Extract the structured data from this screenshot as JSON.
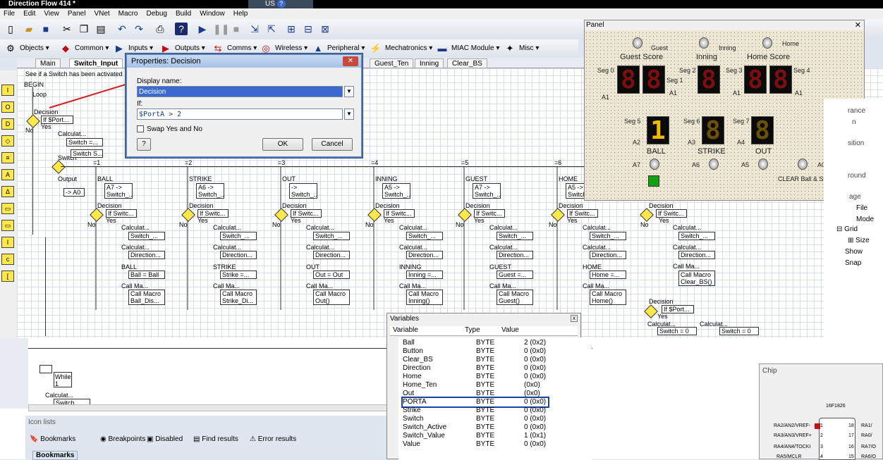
{
  "window": {
    "title": "Direction Flow 414 *",
    "lang": "US"
  },
  "menu": [
    "File",
    "Edit",
    "View",
    "Panel",
    "VNet",
    "Macro",
    "Debug",
    "Build",
    "Window",
    "Help"
  ],
  "components": [
    {
      "label": "Objects"
    },
    {
      "label": "Common"
    },
    {
      "label": "Inputs"
    },
    {
      "label": "Outputs"
    },
    {
      "label": "Comms"
    },
    {
      "label": "Wireless"
    },
    {
      "label": "Peripheral"
    },
    {
      "label": "Mechatronics"
    },
    {
      "label": "MIAC Module"
    },
    {
      "label": "Misc"
    }
  ],
  "tabs": [
    "Main",
    "Switch_Input",
    "Guest_Ten",
    "Inning",
    "Clear_BS"
  ],
  "canvas": {
    "comment": "See if a Switch has been activated",
    "begin": "BEGIN",
    "loop": "Loop",
    "decision": "Decision",
    "if_port": "If  $Port...",
    "no": "No",
    "yes": "Yes",
    "calc": "Calculat...",
    "switch_eq": "Switch =...",
    "switch_lbl": "Switch",
    "switch_s": "Switch S...",
    "output": "Output",
    "a0": "-> A0",
    "while": "While",
    "while1": "1"
  },
  "cases": [
    {
      "num": "=1",
      "name": "BALL",
      "a": "A7 ->",
      "sw": "Switch_...",
      "var": "Ball = Ball",
      "macro": "Ball_Dis..."
    },
    {
      "num": "=2",
      "name": "STRIKE",
      "a": "A6 ->",
      "sw": "Switch_...",
      "var": "Strike =...",
      "macro": "Strike_Di..."
    },
    {
      "num": "=3",
      "name": "OUT",
      "a": "-> ",
      "sw": "Switch_...",
      "var": "Out = Out",
      "macro": "Out()"
    },
    {
      "num": "=4",
      "name": "INNING",
      "a": "A5 ->",
      "sw": "Switch_...",
      "var": "Inning =...",
      "macro": "Inning()"
    },
    {
      "num": "=5",
      "name": "GUEST",
      "a": "A7 ->",
      "sw": "Switch_...",
      "var": "Guest =...",
      "macro": "Guest()"
    },
    {
      "num": "=6",
      "name": "HOME",
      "a": "A5 ->",
      "sw": "Switch",
      "var": "Home =...",
      "macro": "Home()"
    }
  ],
  "case_labels": {
    "decision": "Decision",
    "if": "If  Switc...",
    "calc": "Calculat...",
    "switch": "Switch_...",
    "direction": "Direction...",
    "callma": "Call Ma...",
    "callmacro": "Call Macro",
    "no": "No",
    "yes": "Yes"
  },
  "clear_case": {
    "callma": "Call Ma...",
    "callmacro": "Call Macro",
    "macro": "Clear_BS()",
    "decision": "Decision",
    "if": "If  $Port...",
    "yes": "Yes",
    "calc": "Calculat...",
    "sw0": "Switch = 0"
  },
  "dialog": {
    "title": "Properties: Decision",
    "display_label": "Display name:",
    "display_value": "Decision",
    "if_label": "If:",
    "if_value": "$PortA > 2",
    "swap_label": "Swap Yes and No",
    "help": "?",
    "ok": "OK",
    "cancel": "Cancel"
  },
  "panel": {
    "title": "Panel",
    "guest": "Guest",
    "inning": "Inning",
    "home": "Home",
    "guest_score": "Guest Score",
    "inning_lbl": "Inning",
    "home_score": "Home Score",
    "seg0": "Seg 0",
    "seg1": "Seg 1",
    "seg2": "Seg 2",
    "seg3": "Seg 3",
    "seg4": "Seg 4",
    "seg5": "Seg 5",
    "seg6": "Seg 6",
    "seg7": "Seg 7",
    "a1": "A1",
    "a2": "A2",
    "a3": "A3",
    "a4": "A4",
    "a5": "A5",
    "a6": "A6",
    "a7": "A7",
    "a0": "A0",
    "ball": "BALL",
    "strike": "STRIKE",
    "out": "OUT",
    "clear": "CLEAR Ball & Strike",
    "digit8": "8",
    "digit1": "1"
  },
  "props": [
    "rance",
    "n",
    "sition",
    "round",
    "age",
    "File",
    "Mode",
    "Grid",
    "Size",
    "Show",
    "Snap"
  ],
  "variables": {
    "title": "Variables",
    "headers": [
      "Variable",
      "Type",
      "Value"
    ],
    "rows": [
      [
        "Ball",
        "BYTE",
        "2 (0x2)"
      ],
      [
        "Button",
        "BYTE",
        "0 (0x0)"
      ],
      [
        "Clear_BS",
        "BYTE",
        "0 (0x0)"
      ],
      [
        "Direction",
        "BYTE",
        "0 (0x0)"
      ],
      [
        "Home",
        "BYTE",
        "0 (0x0)"
      ],
      [
        "Home_Ten",
        "BYTE",
        "(0x0)"
      ],
      [
        "Out",
        "BYTE",
        "(0x0)"
      ],
      [
        "PORTA",
        "BYTE",
        "0 (0x0)"
      ],
      [
        "Strike",
        "BYTE",
        "0 (0x0)"
      ],
      [
        "Switch",
        "BYTE",
        "0 (0x0)"
      ],
      [
        "Switch_Active",
        "BYTE",
        "0 (0x0)"
      ],
      [
        "Switch_Value",
        "BYTE",
        "1 (0x1)"
      ],
      [
        "Value",
        "BYTE",
        "0 (0x0)"
      ]
    ]
  },
  "iconlists": {
    "title": "Icon lists",
    "bookmarks": "Bookmarks",
    "breakpoints": "Breakpoints",
    "disabled": "Disabled",
    "find": "Find results",
    "errors": "Error results",
    "tab": "Bookmarks"
  },
  "chip": {
    "title": "Chip",
    "model": "16F1826",
    "pins_left": [
      "RA2/AN2/VREF-",
      "RA3/AN3/VREF+",
      "RA4/AN4/TOCKI",
      "RA5/MCLR"
    ],
    "pins_right": [
      "RA1/",
      "RA0/",
      "RA7/O",
      "RA6/O"
    ],
    "nums_left": [
      "1",
      "2",
      "3",
      "4"
    ],
    "nums_right": [
      "18",
      "17",
      "16",
      "15"
    ]
  }
}
